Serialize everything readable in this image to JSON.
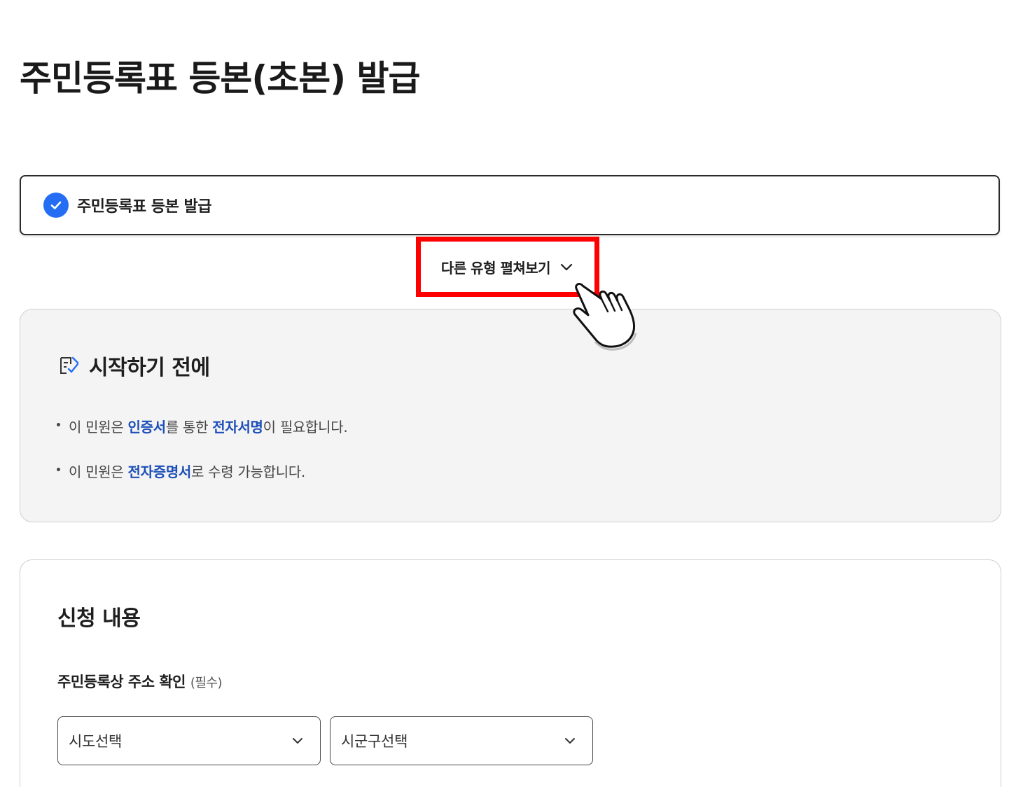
{
  "page": {
    "title": "주민등록표 등본(초본) 발급"
  },
  "selected_type": {
    "label": "주민등록표 등본 발급"
  },
  "expand": {
    "label": "다른 유형 펼쳐보기"
  },
  "before_start": {
    "title": "시작하기 전에",
    "items": [
      {
        "p1": "이 민원은 ",
        "h1": "인증서",
        "p2": "를 통한 ",
        "h2": "전자서명",
        "p3": "이 필요합니다."
      },
      {
        "p1": "이 민원은 ",
        "h1": "전자증명서",
        "p2": "로 수령 가능합니다."
      }
    ]
  },
  "application": {
    "title": "신청 내용",
    "address_label": "주민등록상 주소 확인",
    "required_label": "(필수)",
    "sido_select": "시도선택",
    "sigungu_select": "시군구선택"
  },
  "colors": {
    "accent": "#256ef4",
    "highlight_text": "#1d4fb8",
    "annotation": "#ff0000"
  }
}
